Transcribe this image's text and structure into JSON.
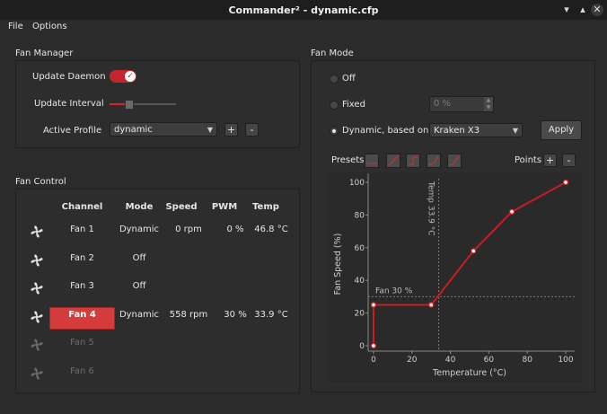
{
  "window": {
    "title": "Commander² - dynamic.cfp",
    "min_glyph": "▾",
    "max_glyph": "▴",
    "close_glyph": "✕"
  },
  "menu": {
    "file": "File",
    "options": "Options"
  },
  "fan_manager": {
    "title": "Fan Manager",
    "update_daemon_label": "Update Daemon",
    "update_daemon_on": true,
    "update_daemon_check": "✓",
    "update_interval_label": "Update Interval",
    "update_interval_level": 0.28,
    "active_profile_label": "Active Profile",
    "active_profile_value": "dynamic",
    "add_label": "+",
    "remove_label": "-"
  },
  "fan_control": {
    "title": "Fan Control",
    "headers": {
      "channel": "Channel",
      "mode": "Mode",
      "speed": "Speed",
      "pwm": "PWM",
      "temp": "Temp"
    },
    "rows": [
      {
        "channel": "Fan 1",
        "mode": "Dynamic",
        "speed": "0 rpm",
        "pwm": "0 %",
        "temp": "46.8 °C",
        "enabled": true,
        "selected": false
      },
      {
        "channel": "Fan 2",
        "mode": "Off",
        "speed": "",
        "pwm": "",
        "temp": "",
        "enabled": true,
        "selected": false
      },
      {
        "channel": "Fan 3",
        "mode": "Off",
        "speed": "",
        "pwm": "",
        "temp": "",
        "enabled": true,
        "selected": false
      },
      {
        "channel": "Fan 4",
        "mode": "Dynamic",
        "speed": "558 rpm",
        "pwm": "30 %",
        "temp": "33.9 °C",
        "enabled": true,
        "selected": true
      },
      {
        "channel": "Fan 5",
        "mode": "",
        "speed": "",
        "pwm": "",
        "temp": "",
        "enabled": false,
        "selected": false
      },
      {
        "channel": "Fan 6",
        "mode": "",
        "speed": "",
        "pwm": "",
        "temp": "",
        "enabled": false,
        "selected": false
      }
    ]
  },
  "fan_mode": {
    "title": "Fan Mode",
    "off_label": "Off",
    "fixed_label": "Fixed",
    "fixed_value": "0 %",
    "dynamic_label": "Dynamic, based on",
    "dynamic_source": "Kraken X3",
    "selected": "dynamic",
    "apply_label": "Apply",
    "presets_label": "Presets",
    "points_label": "Points",
    "points_add": "+",
    "points_remove": "-"
  },
  "chart_data": {
    "type": "line",
    "xlabel": "Temperature (°C)",
    "ylabel": "Fan Speed (%)",
    "xlim": [
      0,
      100
    ],
    "ylim": [
      0,
      100
    ],
    "xticks": [
      0,
      20,
      40,
      60,
      80,
      100
    ],
    "yticks": [
      0,
      20,
      40,
      60,
      80,
      100
    ],
    "series": [
      {
        "x": [
          0,
          0,
          30,
          52,
          72,
          100
        ],
        "y": [
          0,
          25,
          25,
          58,
          82,
          100
        ]
      }
    ],
    "current_temp_label": "Temp 33.9 °C",
    "current_temp": 33.9,
    "current_fan_label": "Fan 30 %",
    "current_fan": 30,
    "line_color": "#c81e1e",
    "point_fill": "#ffffff"
  },
  "colors": {
    "accent": "#d43c3c",
    "background": "#2b2b2b"
  }
}
